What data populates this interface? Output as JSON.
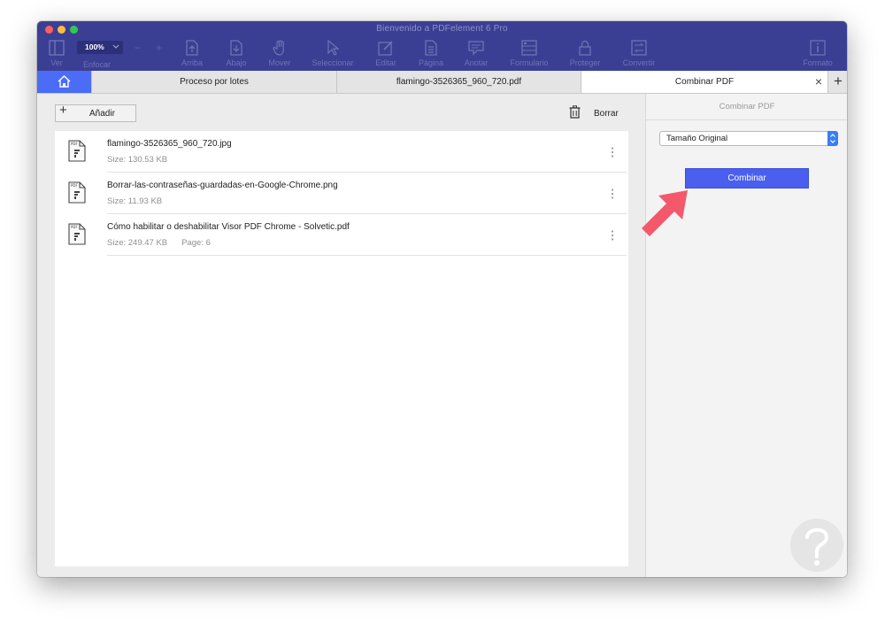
{
  "window": {
    "title": "Bienvenido a PDFelement 6 Pro"
  },
  "toolbar": {
    "zoom": "100%",
    "zoom_minus": "−",
    "zoom_plus": "+",
    "items": [
      {
        "label": "Ver",
        "icon": "view-icon"
      },
      {
        "label": "Enfocar",
        "icon": "focus-icon"
      },
      {
        "label": "Arriba",
        "icon": "page-up-icon"
      },
      {
        "label": "Abajo",
        "icon": "page-down-icon"
      },
      {
        "label": "Mover",
        "icon": "hand-icon"
      },
      {
        "label": "Seleccionar",
        "icon": "cursor-icon"
      },
      {
        "label": "Editar",
        "icon": "edit-icon"
      },
      {
        "label": "Página",
        "icon": "page-icon"
      },
      {
        "label": "Anotar",
        "icon": "comment-icon"
      },
      {
        "label": "Formulario",
        "icon": "form-icon"
      },
      {
        "label": "Proteger",
        "icon": "lock-icon"
      },
      {
        "label": "Convertir",
        "icon": "convert-icon"
      },
      {
        "label": "Formato",
        "icon": "format-icon"
      }
    ]
  },
  "tabs": [
    {
      "label": "Proceso por lotes"
    },
    {
      "label": "flamingo-3526365_960_720.pdf"
    },
    {
      "label": "Combinar PDF",
      "active": true
    }
  ],
  "tab_close": "×",
  "tab_add": "+",
  "main": {
    "add_label": "Añadir",
    "add_icon": "+",
    "delete_label": "Borrar",
    "files": [
      {
        "name": "flamingo-3526365_960_720.jpg",
        "size": "Size: 130.53 KB",
        "pages": ""
      },
      {
        "name": "Borrar-las-contraseñas-guardadas-en-Google-Chrome.png",
        "size": "Size: 11.93 KB",
        "pages": ""
      },
      {
        "name": "Cómo habilitar o deshabilitar Visor PDF Chrome - Solvetic.pdf",
        "size": "Size: 249.47 KB",
        "pages": "Page: 6"
      }
    ]
  },
  "side": {
    "title": "Combinar PDF",
    "size_option": "Tamaño Original",
    "combine_label": "Combinar"
  },
  "colors": {
    "toolbar": "#3b3f94",
    "accent": "#4a6cf7",
    "button": "#4a5ff0",
    "annotation_arrow": "#f4586b"
  }
}
